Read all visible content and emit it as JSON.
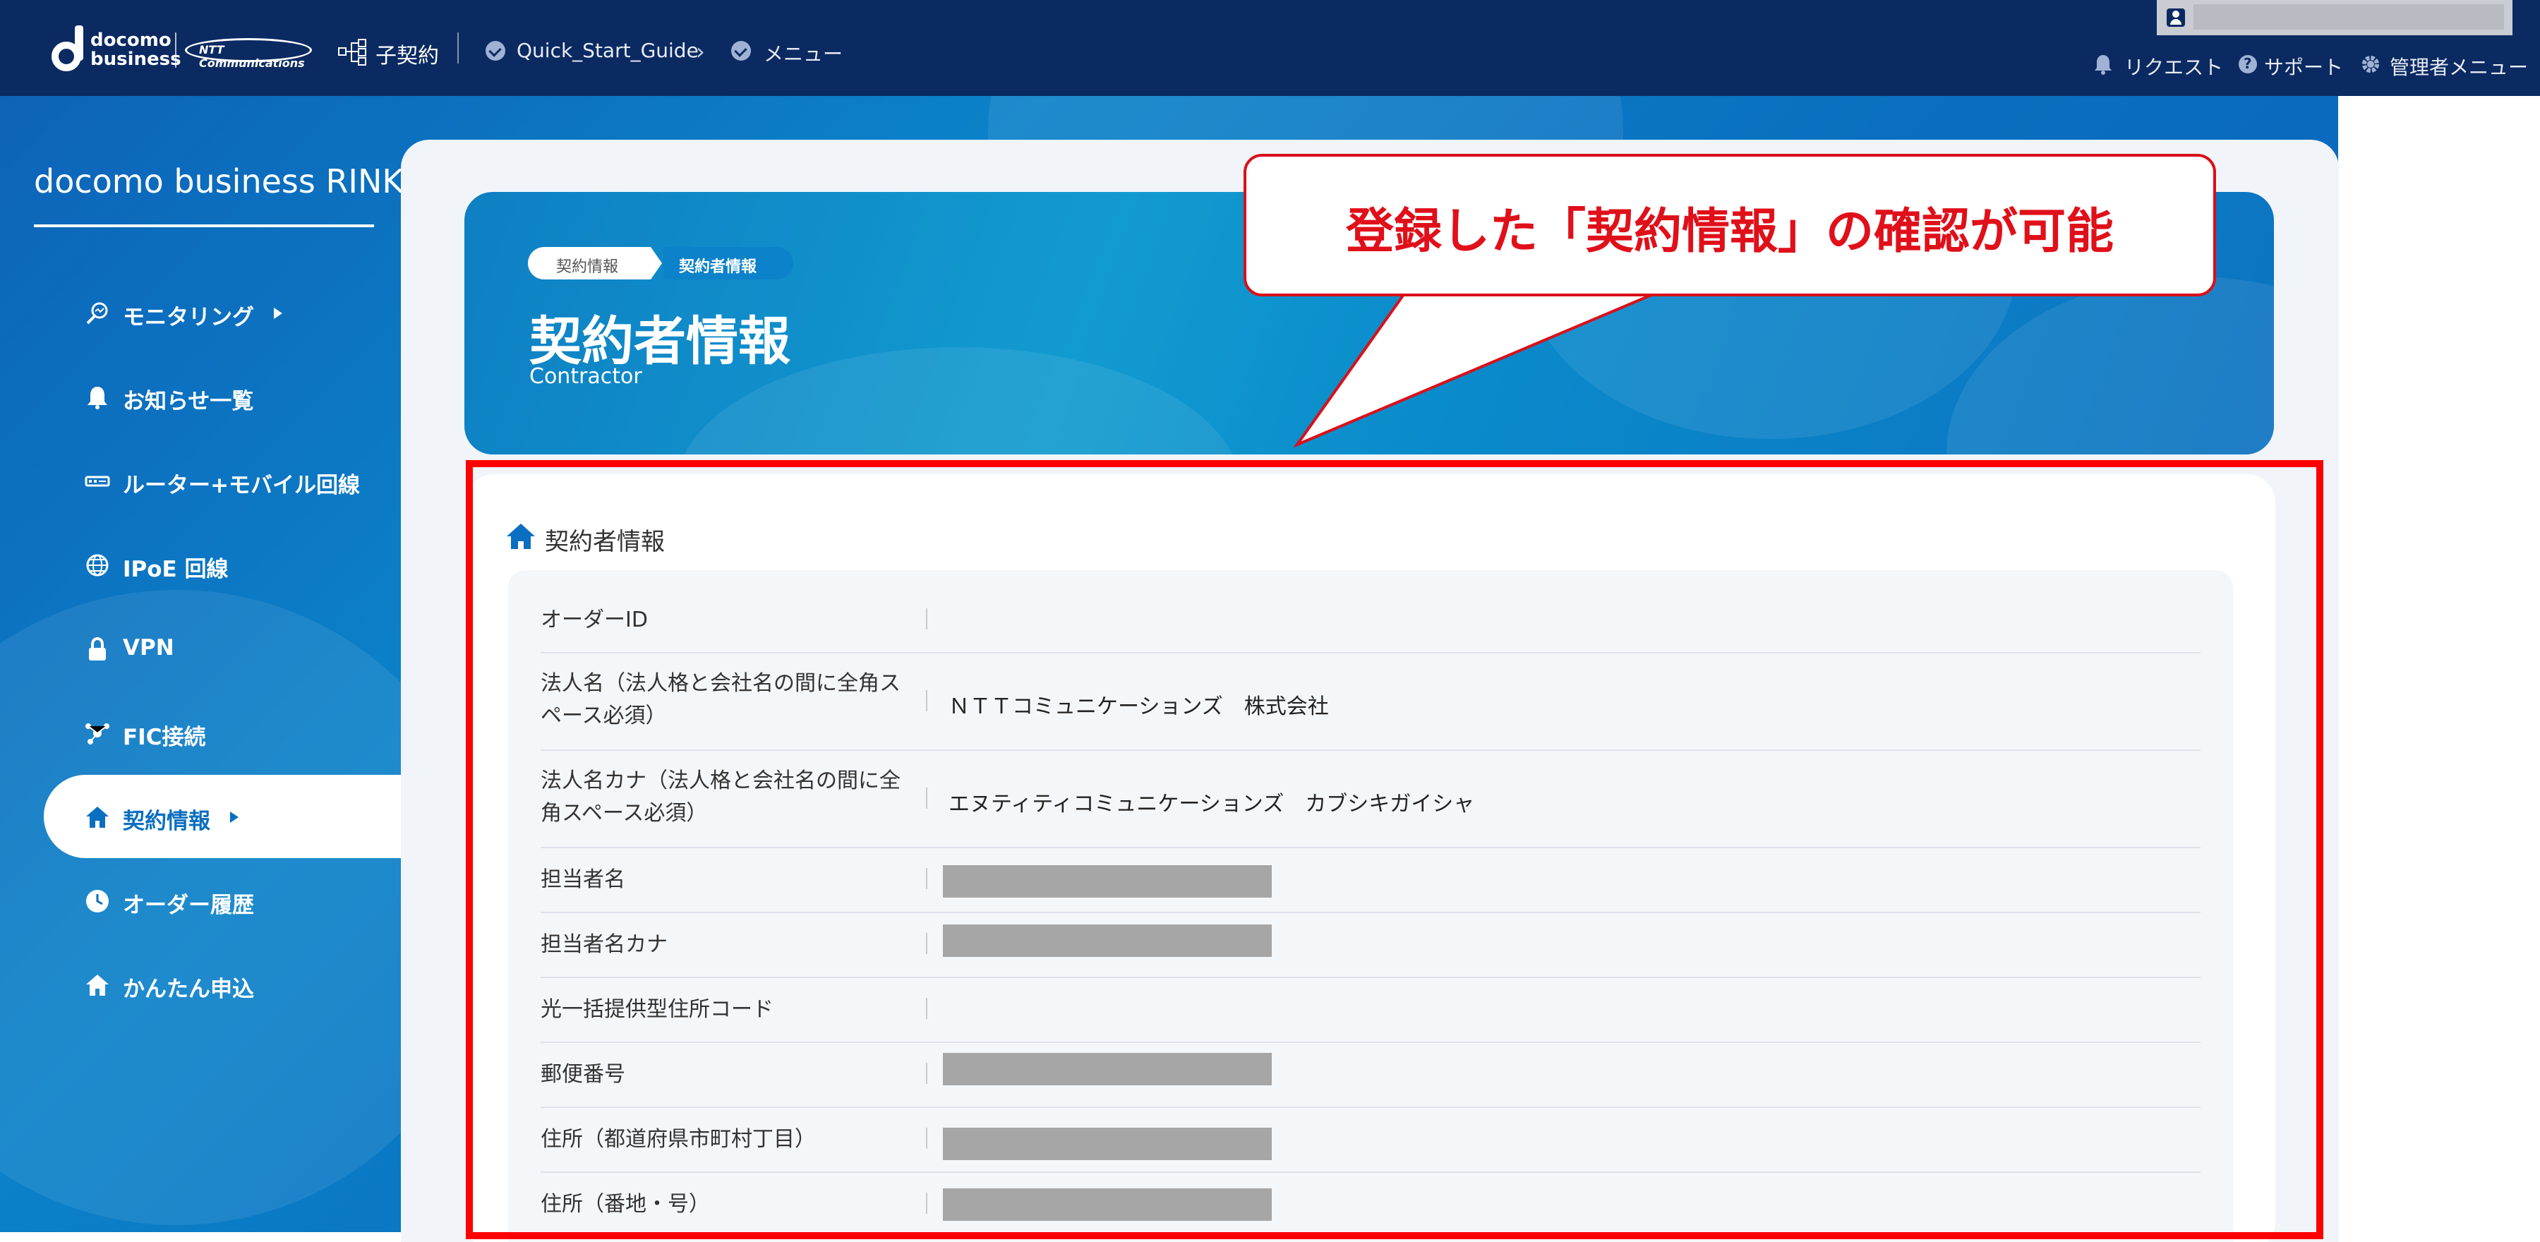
{
  "header": {
    "logo_text": "docomo business",
    "ntt_logo_text": "NTT Communications",
    "contract_label": "子契約",
    "breadcrumb": [
      "Quick_Start_Guide",
      "メニュー"
    ],
    "links": {
      "request": "リクエスト",
      "support": "サポート",
      "admin": "管理者メニュー"
    }
  },
  "sidebar": {
    "brand": "docomo business RINK",
    "items": [
      {
        "label": "モニタリング",
        "icon": "monitor-icon",
        "arrow": true
      },
      {
        "label": "お知らせ一覧",
        "icon": "bell-icon",
        "arrow": false
      },
      {
        "label": "ルーター+モバイル回線",
        "icon": "router-icon",
        "arrow": false
      },
      {
        "label": "IPoE 回線",
        "icon": "globe-icon",
        "arrow": false
      },
      {
        "label": "VPN",
        "icon": "lock-icon",
        "arrow": false
      },
      {
        "label": "FIC接続",
        "icon": "network-icon",
        "arrow": false
      },
      {
        "label": "契約情報",
        "icon": "home-icon",
        "arrow": true,
        "active": true
      },
      {
        "label": "オーダー履歴",
        "icon": "clock-icon",
        "arrow": false
      },
      {
        "label": "かんたん申込",
        "icon": "home-icon",
        "arrow": false
      }
    ]
  },
  "hero": {
    "breadcrumb": [
      "契約情報",
      "契約者情報"
    ],
    "title": "契約者情報",
    "subtitle": "Contractor"
  },
  "callout": {
    "text": "登録した「契約情報」の確認が可能"
  },
  "section": {
    "title": "契約者情報",
    "rows": [
      {
        "key": "オーダーID",
        "value": "",
        "redacted": false
      },
      {
        "key": "法人名（法人格と会社名の間に全角スペース必須）",
        "value": "ＮＴＴコミュニケーションズ　株式会社",
        "redacted": false
      },
      {
        "key": "法人名カナ（法人格と会社名の間に全角スペース必須）",
        "value": "エヌティティコミュニケーションズ　カブシキガイシャ",
        "redacted": false
      },
      {
        "key": "担当者名",
        "value": "",
        "redacted": true
      },
      {
        "key": "担当者名カナ",
        "value": "",
        "redacted": true
      },
      {
        "key": "光一括提供型住所コード",
        "value": "",
        "redacted": false
      },
      {
        "key": "郵便番号",
        "value": "",
        "redacted": true
      },
      {
        "key": "住所（都道府県市町村丁目）",
        "value": "",
        "redacted": true
      },
      {
        "key": "住所（番地・号）",
        "value": "",
        "redacted": true
      }
    ]
  },
  "colors": {
    "header_bg": "#0b2a62",
    "accent": "#0a6fc0",
    "highlight": "#ff0000",
    "callout_text": "#e0101a"
  }
}
